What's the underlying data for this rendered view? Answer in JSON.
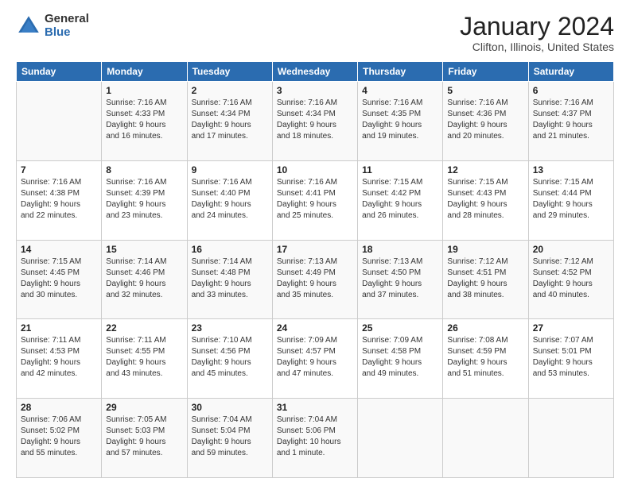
{
  "header": {
    "logo_general": "General",
    "logo_blue": "Blue",
    "month_title": "January 2024",
    "location": "Clifton, Illinois, United States"
  },
  "days_of_week": [
    "Sunday",
    "Monday",
    "Tuesday",
    "Wednesday",
    "Thursday",
    "Friday",
    "Saturday"
  ],
  "weeks": [
    [
      {
        "day": "",
        "info": ""
      },
      {
        "day": "1",
        "info": "Sunrise: 7:16 AM\nSunset: 4:33 PM\nDaylight: 9 hours\nand 16 minutes."
      },
      {
        "day": "2",
        "info": "Sunrise: 7:16 AM\nSunset: 4:34 PM\nDaylight: 9 hours\nand 17 minutes."
      },
      {
        "day": "3",
        "info": "Sunrise: 7:16 AM\nSunset: 4:34 PM\nDaylight: 9 hours\nand 18 minutes."
      },
      {
        "day": "4",
        "info": "Sunrise: 7:16 AM\nSunset: 4:35 PM\nDaylight: 9 hours\nand 19 minutes."
      },
      {
        "day": "5",
        "info": "Sunrise: 7:16 AM\nSunset: 4:36 PM\nDaylight: 9 hours\nand 20 minutes."
      },
      {
        "day": "6",
        "info": "Sunrise: 7:16 AM\nSunset: 4:37 PM\nDaylight: 9 hours\nand 21 minutes."
      }
    ],
    [
      {
        "day": "7",
        "info": "Sunrise: 7:16 AM\nSunset: 4:38 PM\nDaylight: 9 hours\nand 22 minutes."
      },
      {
        "day": "8",
        "info": "Sunrise: 7:16 AM\nSunset: 4:39 PM\nDaylight: 9 hours\nand 23 minutes."
      },
      {
        "day": "9",
        "info": "Sunrise: 7:16 AM\nSunset: 4:40 PM\nDaylight: 9 hours\nand 24 minutes."
      },
      {
        "day": "10",
        "info": "Sunrise: 7:16 AM\nSunset: 4:41 PM\nDaylight: 9 hours\nand 25 minutes."
      },
      {
        "day": "11",
        "info": "Sunrise: 7:15 AM\nSunset: 4:42 PM\nDaylight: 9 hours\nand 26 minutes."
      },
      {
        "day": "12",
        "info": "Sunrise: 7:15 AM\nSunset: 4:43 PM\nDaylight: 9 hours\nand 28 minutes."
      },
      {
        "day": "13",
        "info": "Sunrise: 7:15 AM\nSunset: 4:44 PM\nDaylight: 9 hours\nand 29 minutes."
      }
    ],
    [
      {
        "day": "14",
        "info": "Sunrise: 7:15 AM\nSunset: 4:45 PM\nDaylight: 9 hours\nand 30 minutes."
      },
      {
        "day": "15",
        "info": "Sunrise: 7:14 AM\nSunset: 4:46 PM\nDaylight: 9 hours\nand 32 minutes."
      },
      {
        "day": "16",
        "info": "Sunrise: 7:14 AM\nSunset: 4:48 PM\nDaylight: 9 hours\nand 33 minutes."
      },
      {
        "day": "17",
        "info": "Sunrise: 7:13 AM\nSunset: 4:49 PM\nDaylight: 9 hours\nand 35 minutes."
      },
      {
        "day": "18",
        "info": "Sunrise: 7:13 AM\nSunset: 4:50 PM\nDaylight: 9 hours\nand 37 minutes."
      },
      {
        "day": "19",
        "info": "Sunrise: 7:12 AM\nSunset: 4:51 PM\nDaylight: 9 hours\nand 38 minutes."
      },
      {
        "day": "20",
        "info": "Sunrise: 7:12 AM\nSunset: 4:52 PM\nDaylight: 9 hours\nand 40 minutes."
      }
    ],
    [
      {
        "day": "21",
        "info": "Sunrise: 7:11 AM\nSunset: 4:53 PM\nDaylight: 9 hours\nand 42 minutes."
      },
      {
        "day": "22",
        "info": "Sunrise: 7:11 AM\nSunset: 4:55 PM\nDaylight: 9 hours\nand 43 minutes."
      },
      {
        "day": "23",
        "info": "Sunrise: 7:10 AM\nSunset: 4:56 PM\nDaylight: 9 hours\nand 45 minutes."
      },
      {
        "day": "24",
        "info": "Sunrise: 7:09 AM\nSunset: 4:57 PM\nDaylight: 9 hours\nand 47 minutes."
      },
      {
        "day": "25",
        "info": "Sunrise: 7:09 AM\nSunset: 4:58 PM\nDaylight: 9 hours\nand 49 minutes."
      },
      {
        "day": "26",
        "info": "Sunrise: 7:08 AM\nSunset: 4:59 PM\nDaylight: 9 hours\nand 51 minutes."
      },
      {
        "day": "27",
        "info": "Sunrise: 7:07 AM\nSunset: 5:01 PM\nDaylight: 9 hours\nand 53 minutes."
      }
    ],
    [
      {
        "day": "28",
        "info": "Sunrise: 7:06 AM\nSunset: 5:02 PM\nDaylight: 9 hours\nand 55 minutes."
      },
      {
        "day": "29",
        "info": "Sunrise: 7:05 AM\nSunset: 5:03 PM\nDaylight: 9 hours\nand 57 minutes."
      },
      {
        "day": "30",
        "info": "Sunrise: 7:04 AM\nSunset: 5:04 PM\nDaylight: 9 hours\nand 59 minutes."
      },
      {
        "day": "31",
        "info": "Sunrise: 7:04 AM\nSunset: 5:06 PM\nDaylight: 10 hours\nand 1 minute."
      },
      {
        "day": "",
        "info": ""
      },
      {
        "day": "",
        "info": ""
      },
      {
        "day": "",
        "info": ""
      }
    ]
  ]
}
